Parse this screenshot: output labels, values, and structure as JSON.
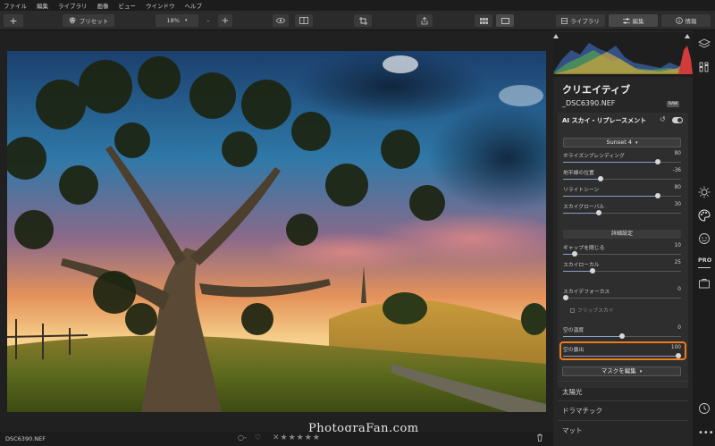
{
  "menu": [
    "ファイル",
    "編集",
    "ライブラリ",
    "画像",
    "ビュー",
    "ウインドウ",
    "ヘルプ"
  ],
  "toolbar": {
    "add_label": "+",
    "preset_label": "プリセット",
    "zoom_value": "18%",
    "zoom_minus": "–",
    "zoom_plus": "+",
    "library_tab": "ライブラリ",
    "edit_tab": "編集",
    "info_tab": "情報"
  },
  "panel": {
    "title": "クリエイティブ",
    "filename": "_DSC6390.NEF",
    "raw_badge": "RAW",
    "ai_section": {
      "title": "AI スカイ・リプレースメント",
      "sky_dropdown": "Sunset 4",
      "sliders_top": [
        {
          "label": "ホライズンブレンディング",
          "value": "80",
          "level": 0.8
        },
        {
          "label": "地平線の位置",
          "value": "-36",
          "level": 0.32
        },
        {
          "label": "リライトシーン",
          "value": "80",
          "level": 0.8
        },
        {
          "label": "スカイグローバル",
          "value": "30",
          "level": 0.3
        }
      ],
      "advanced_label": "詳細設定",
      "sliders_adv": [
        {
          "label": "ギャップを閉じる",
          "value": "10",
          "level": 0.1
        },
        {
          "label": "スカイローカル",
          "value": "25",
          "level": 0.25
        },
        {
          "label": "スカイデフォーカス",
          "value": "0",
          "level": 0.0
        }
      ],
      "flip_label": "フリップスカイ",
      "sliders_bottom": [
        {
          "label": "空の温度",
          "value": "0",
          "level": 0.5
        },
        {
          "label": "空の露出",
          "value": "100",
          "level": 1.0
        }
      ],
      "mask_button": "マスクを編集"
    },
    "sections": [
      "太陽光",
      "ドラマチック",
      "マット"
    ]
  },
  "bottom": {
    "filename": "DSC6390.NEF",
    "flag": "○-",
    "heart": "♡",
    "stars": "✕★★★★★",
    "rating": 0
  },
  "watermark": "PhotograFan.com",
  "colors": {
    "highlight": "#f07a1a",
    "panel_bg": "#262626",
    "slider_fill": "#8aa0c8"
  }
}
